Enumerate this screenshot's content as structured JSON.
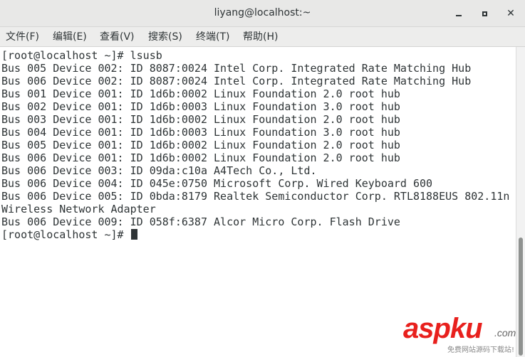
{
  "window": {
    "title": "liyang@localhost:~"
  },
  "menu": [
    {
      "label": "文件(F)"
    },
    {
      "label": "编辑(E)"
    },
    {
      "label": "查看(V)"
    },
    {
      "label": "搜索(S)"
    },
    {
      "label": "终端(T)"
    },
    {
      "label": "帮助(H)"
    }
  ],
  "terminal": {
    "lines": [
      "[root@localhost ~]# lsusb",
      "Bus 005 Device 002: ID 8087:0024 Intel Corp. Integrated Rate Matching Hub",
      "Bus 006 Device 002: ID 8087:0024 Intel Corp. Integrated Rate Matching Hub",
      "Bus 001 Device 001: ID 1d6b:0002 Linux Foundation 2.0 root hub",
      "Bus 002 Device 001: ID 1d6b:0003 Linux Foundation 3.0 root hub",
      "Bus 003 Device 001: ID 1d6b:0002 Linux Foundation 2.0 root hub",
      "Bus 004 Device 001: ID 1d6b:0003 Linux Foundation 3.0 root hub",
      "Bus 005 Device 001: ID 1d6b:0002 Linux Foundation 2.0 root hub",
      "Bus 006 Device 001: ID 1d6b:0002 Linux Foundation 2.0 root hub",
      "Bus 006 Device 003: ID 09da:c10a A4Tech Co., Ltd.",
      "Bus 006 Device 004: ID 045e:0750 Microsoft Corp. Wired Keyboard 600",
      "Bus 006 Device 005: ID 0bda:8179 Realtek Semiconductor Corp. RTL8188EUS 802.11n",
      "Wireless Network Adapter",
      "Bus 006 Device 009: ID 058f:6387 Alcor Micro Corp. Flash Drive"
    ],
    "prompt": "[root@localhost ~]# "
  },
  "watermark": {
    "logo": "aspku",
    "domain": ".com",
    "tagline": "免费网站源码下载站!"
  }
}
